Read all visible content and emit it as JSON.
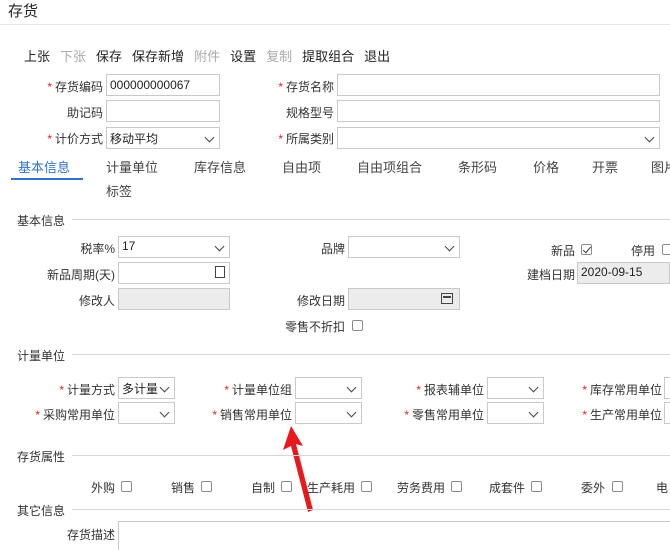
{
  "title": "存货",
  "toolbar": [
    {
      "label": "上张",
      "disabled": false
    },
    {
      "label": "下张",
      "disabled": true
    },
    {
      "label": "保存",
      "disabled": false
    },
    {
      "label": "保存新增",
      "disabled": false
    },
    {
      "label": "附件",
      "disabled": true
    },
    {
      "label": "设置",
      "disabled": false
    },
    {
      "label": "复制",
      "disabled": true
    },
    {
      "label": "提取组合",
      "disabled": false
    },
    {
      "label": "退出",
      "disabled": false
    }
  ],
  "header": {
    "code_label": "存货编码",
    "code_value": "000000000067",
    "name_label": "存货名称",
    "name_value": "",
    "mnemonic_label": "助记码",
    "mnemonic_value": "",
    "spec_label": "规格型号",
    "spec_value": "",
    "pricing_label": "计价方式",
    "pricing_value": "移动平均",
    "category_label": "所属类别",
    "category_value": ""
  },
  "tabs": [
    "基本信息",
    "计量单位",
    "库存信息",
    "自由项",
    "自由项组合",
    "条形码",
    "价格",
    "开票",
    "图片",
    "标签"
  ],
  "basic": {
    "section": "基本信息",
    "tax_label": "税率%",
    "tax_value": "17",
    "brand_label": "品牌",
    "brand_value": "",
    "new_label": "新品",
    "new_checked": true,
    "disabled_label": "停用",
    "disabled_checked": false,
    "new_period_label": "新品周期(天)",
    "new_period_value": "",
    "created_label": "建档日期",
    "created_value": "2020-09-15",
    "modifier_label": "修改人",
    "modifier_value": "",
    "modified_label": "修改日期",
    "modified_value": "",
    "no_discount_label": "零售不折扣",
    "no_discount_checked": false
  },
  "units": {
    "section": "计量单位",
    "method_label": "计量方式",
    "method_value": "多计量",
    "group_label": "计量单位组",
    "group_value": "",
    "report_label": "报表辅单位",
    "report_value": "",
    "stock_label": "库存常用单位",
    "purchase_label": "采购常用单位",
    "purchase_value": "",
    "sales_label": "销售常用单位",
    "sales_value": "",
    "retail_label": "零售常用单位",
    "retail_value": "",
    "production_label": "生产常用单位"
  },
  "attrs": {
    "section": "存货属性",
    "items": [
      "外购",
      "销售",
      "自制",
      "生产耗用",
      "劳务费用",
      "成套件",
      "委外",
      "电"
    ]
  },
  "other": {
    "section": "其它信息",
    "desc_label": "存货描述"
  }
}
